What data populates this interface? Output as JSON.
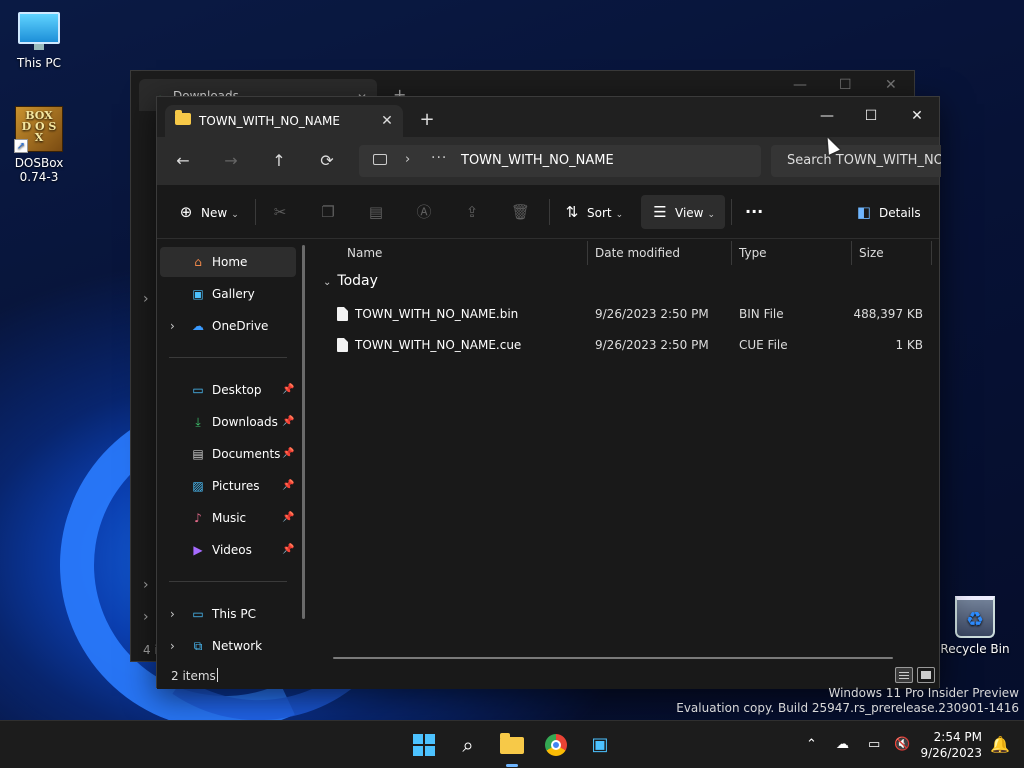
{
  "desktop": {
    "icons": [
      {
        "label": "This PC",
        "icon": "this-pc-icon"
      },
      {
        "label": "DOSBox\n0.74-3",
        "label_line1": "DOSBox",
        "label_line2": "0.74-3",
        "icon": "dosbox-icon"
      },
      {
        "label": "Recycle Bin",
        "icon": "recycle-bin-icon"
      }
    ],
    "watermark": {
      "line1": "Windows 11 Pro Insider Preview",
      "line2": "Evaluation copy. Build 25947.rs_prerelease.230901-1416"
    }
  },
  "back_window": {
    "tab_label": "Downloads",
    "footer_partial": "4 i"
  },
  "explorer": {
    "tab": {
      "label": "TOWN_WITH_NO_NAME",
      "close": "✕",
      "new_tab": "+"
    },
    "window_controls": {
      "minimize": "—",
      "maximize": "☐",
      "close": "✕"
    },
    "nav": {
      "back": "←",
      "forward": "→",
      "up": "↑",
      "refresh": "⟳",
      "address": {
        "separator": "›",
        "overflow": "···",
        "path": "TOWN_WITH_NO_NAME"
      },
      "search_placeholder": "Search TOWN_WITH_NO_NAME"
    },
    "commands": {
      "new": "New",
      "sort": "Sort",
      "view": "View",
      "more": "···",
      "details": "Details"
    },
    "sidebar": {
      "items": [
        {
          "label": "Home",
          "icon": "home-icon",
          "selected": true
        },
        {
          "label": "Gallery",
          "icon": "gallery-icon"
        },
        {
          "label": "OneDrive",
          "icon": "onedrive-icon",
          "expandable": true
        },
        {
          "label": "Desktop",
          "icon": "desktop-icon",
          "pinned": true
        },
        {
          "label": "Downloads",
          "icon": "downloads-icon",
          "pinned": true
        },
        {
          "label": "Documents",
          "icon": "documents-icon",
          "pinned": true
        },
        {
          "label": "Pictures",
          "icon": "pictures-icon",
          "pinned": true
        },
        {
          "label": "Music",
          "icon": "music-icon",
          "pinned": true
        },
        {
          "label": "Videos",
          "icon": "videos-icon",
          "pinned": true
        },
        {
          "label": "This PC",
          "icon": "this-pc-icon",
          "expandable": true
        },
        {
          "label": "Network",
          "icon": "network-icon",
          "expandable": true
        }
      ]
    },
    "columns": [
      "Name",
      "Date modified",
      "Type",
      "Size"
    ],
    "group": "Today",
    "files": [
      {
        "name": "TOWN_WITH_NO_NAME.bin",
        "date": "9/26/2023 2:50 PM",
        "type": "BIN File",
        "size": "488,397 KB"
      },
      {
        "name": "TOWN_WITH_NO_NAME.cue",
        "date": "9/26/2023 2:50 PM",
        "type": "CUE File",
        "size": "1 KB"
      }
    ],
    "status": "2 items"
  },
  "taskbar": {
    "apps": [
      "start-button",
      "search",
      "file-explorer",
      "chrome",
      "dosbox-setup"
    ],
    "clock": {
      "time": "2:54 PM",
      "date": "9/26/2023"
    },
    "accent": "#4cc2ff"
  }
}
